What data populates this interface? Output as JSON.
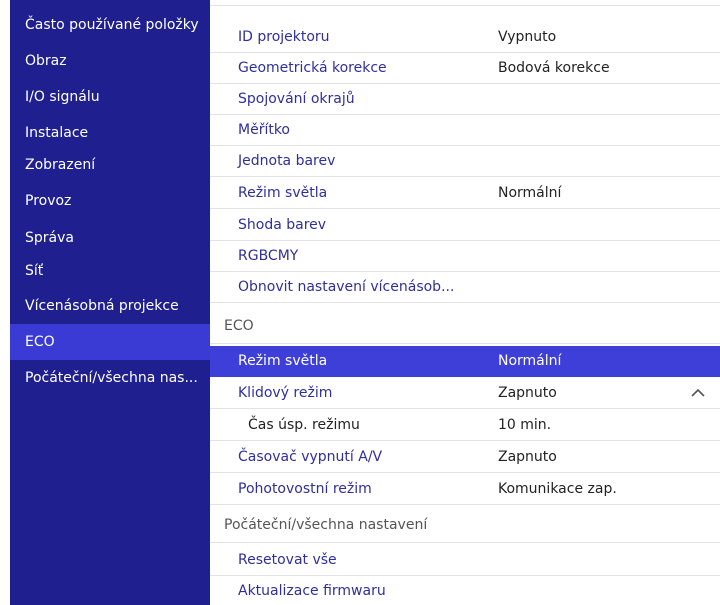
{
  "sidebar": {
    "items": [
      {
        "label": "Často používané položky"
      },
      {
        "label": "Obraz"
      },
      {
        "label": "I/O signálu"
      },
      {
        "label": "Instalace"
      },
      {
        "label": "Zobrazení"
      },
      {
        "label": "Provoz"
      },
      {
        "label": "Správa"
      },
      {
        "label": "Síť"
      },
      {
        "label": "Vícenásobná projekce"
      },
      {
        "label": "ECO"
      },
      {
        "label": "Počáteční/všechna nas..."
      }
    ],
    "active": "ECO"
  },
  "multi_projection": {
    "items": [
      {
        "label": "ID projektoru",
        "value": "Vypnuto"
      },
      {
        "label": "Geometrická korekce",
        "value": "Bodová korekce"
      },
      {
        "label": "Spojování okrajů",
        "value": ""
      },
      {
        "label": "Měřítko",
        "value": ""
      },
      {
        "label": "Jednota barev",
        "value": ""
      },
      {
        "label": "Režim světla",
        "value": "Normální"
      },
      {
        "label": "Shoda barev",
        "value": ""
      },
      {
        "label": "RGBCMY",
        "value": ""
      },
      {
        "label": "Obnovit nastavení vícenásob...",
        "value": ""
      }
    ]
  },
  "eco": {
    "header": "ECO",
    "items": [
      {
        "label": "Režim světla",
        "value": "Normální"
      },
      {
        "label": "Klidový režim",
        "value": "Zapnuto"
      },
      {
        "label": "Čas úsp. režimu",
        "value": "10 min."
      },
      {
        "label": "Časovač vypnutí A/V",
        "value": "Zapnuto"
      },
      {
        "label": "Pohotovostní režim",
        "value": "Komunikace zap."
      }
    ],
    "expanded_icon": "chevron-up-icon"
  },
  "initial": {
    "header": "Počáteční/všechna nastavení",
    "items": [
      {
        "label": "Resetovat vše"
      },
      {
        "label": "Aktualizace firmwaru"
      }
    ]
  },
  "colors": {
    "sidebar_bg": "#1f1f8f",
    "sidebar_active": "#3a3ad4",
    "selected_row": "#3e3ed8",
    "item_text": "#2f2f9c"
  }
}
